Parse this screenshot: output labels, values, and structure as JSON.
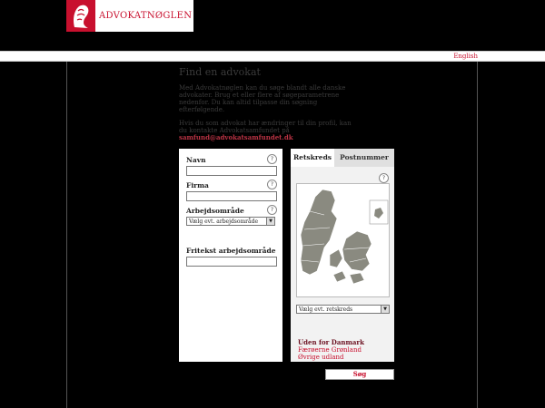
{
  "header": {
    "brand_text": "ADVOKATNØGLEN",
    "lang_link": "English"
  },
  "intro": {
    "title": "Find en advokat",
    "para1": "Med Advokatnøglen kan du søge blandt alle danske advokater. Brug et eller flere af søgeparametrene nedenfor. Du kan altid tilpasse din søgning efterfølgende.",
    "para2_prefix": "Hvis du som advokat har ændringer til din profil, kan du kontakte Advokatsamfundet på ",
    "para2_email": "samfund@advokatsamfundet.dk"
  },
  "form": {
    "name_label": "Navn",
    "firm_label": "Firma",
    "area_label": "Arbejdsområde",
    "area_placeholder": "Vælg evt. arbejdsområde",
    "freetext_label": "Fritekst arbejdsområde",
    "help_glyph": "?"
  },
  "region": {
    "tab_active": "Retskreds",
    "tab_inactive": "Postnummer",
    "select_placeholder": "Vælg evt. retskreds",
    "abroad_heading": "Uden for Danmark",
    "abroad_link1": "Færøerne Grønland",
    "abroad_link2": "Øvrige udland"
  },
  "search_button": "Søg",
  "colors": {
    "accent": "#c8102e",
    "background": "#000000",
    "map_fill": "#8a8a80"
  }
}
